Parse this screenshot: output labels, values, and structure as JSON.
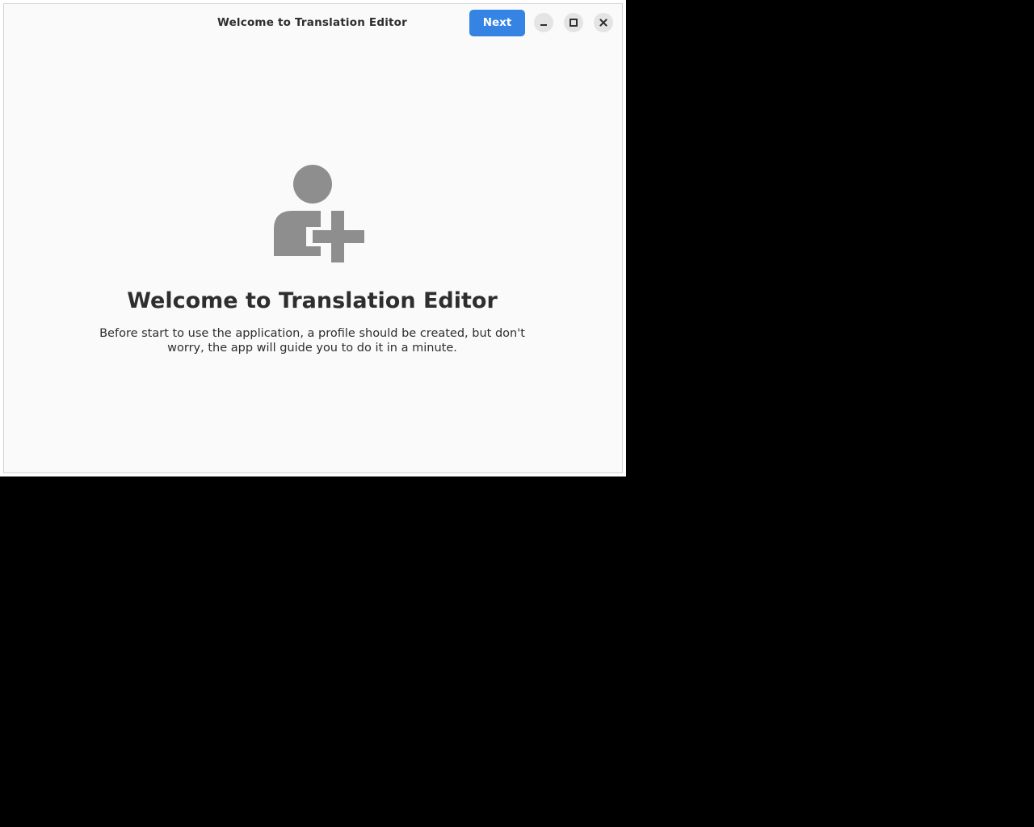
{
  "window": {
    "title": "Welcome to Translation Editor",
    "next_label": "Next"
  },
  "welcome": {
    "icon": "add-user-icon",
    "heading": "Welcome to Translation Editor",
    "description": "Before start to use the application, a profile should be created, but don't worry, the app will guide you to do it in a minute."
  },
  "colors": {
    "accent": "#3584e4",
    "icon": "#8e8e8e",
    "text": "#2e2e2e",
    "background": "#fafafa"
  }
}
